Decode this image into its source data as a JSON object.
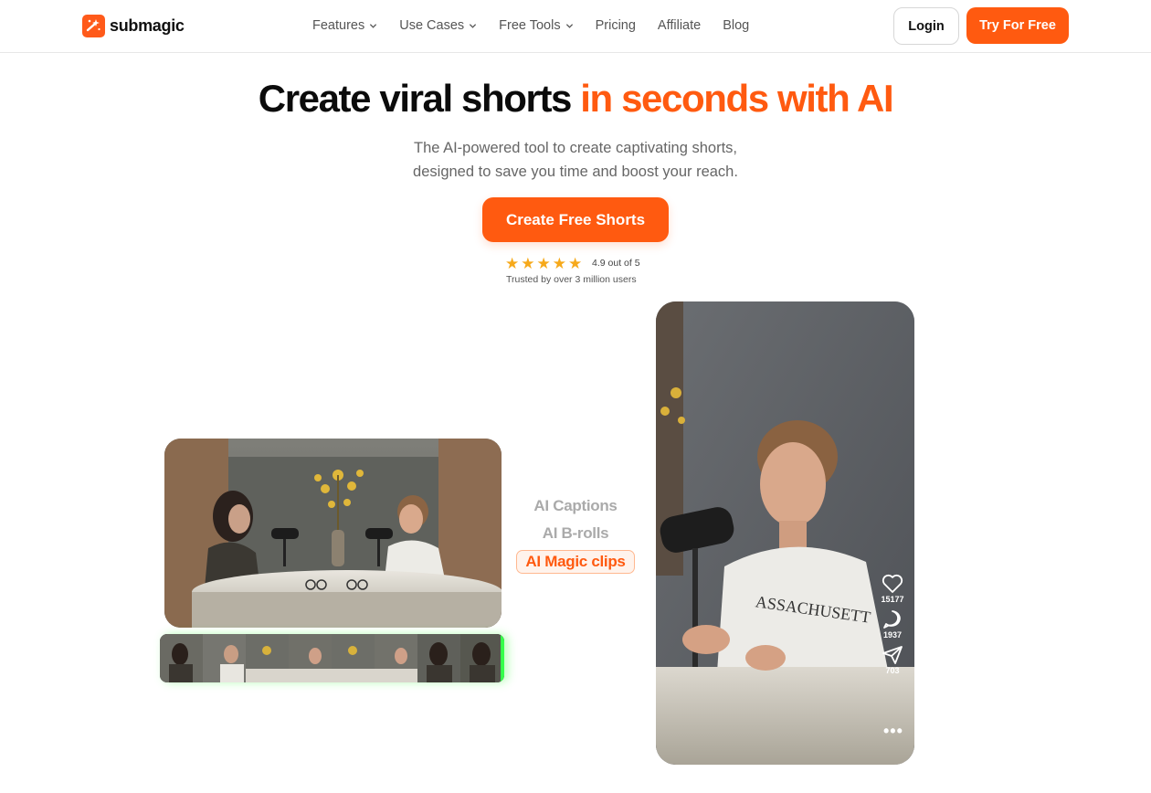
{
  "brand": {
    "name": "submagic",
    "accent": "#ff5a10"
  },
  "nav": {
    "items": [
      {
        "label": "Features",
        "has_dropdown": true
      },
      {
        "label": "Use Cases",
        "has_dropdown": true
      },
      {
        "label": "Free Tools",
        "has_dropdown": true
      },
      {
        "label": "Pricing",
        "has_dropdown": false
      },
      {
        "label": "Affiliate",
        "has_dropdown": false
      },
      {
        "label": "Blog",
        "has_dropdown": false
      }
    ],
    "login_label": "Login",
    "try_label": "Try For Free"
  },
  "hero": {
    "title_plain": "Create viral shorts ",
    "title_accent": "in seconds with AI",
    "subtitle_line1": "The AI-powered tool to create captivating shorts,",
    "subtitle_line2": "designed to save you time and boost your reach.",
    "cta_label": "Create Free Shorts",
    "rating_score": "4.9 out of 5",
    "rating_stars": 5,
    "rating_trust": "Trusted by over 3 million users"
  },
  "features": {
    "items": [
      "AI Captions",
      "AI B-rolls",
      "AI Magic clips"
    ],
    "active_index": 2
  },
  "phone": {
    "likes": "15177",
    "comments": "1937",
    "shares": "703"
  }
}
